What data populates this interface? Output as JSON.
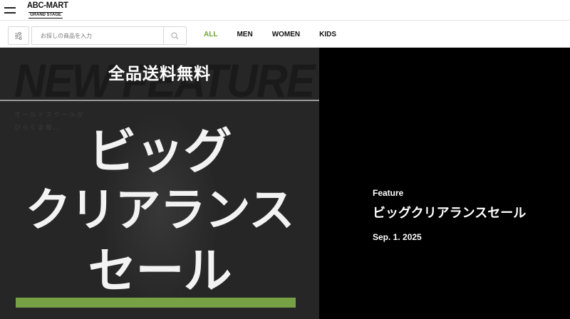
{
  "header": {
    "menu_icon": "hamburger-icon",
    "logo_main": "ABC-MART",
    "logo_sub": "GRAND STAGE"
  },
  "search": {
    "filter_icon": "sliders-icon",
    "placeholder": "お探しの商品を入力",
    "value": "",
    "search_icon": "search-icon"
  },
  "nav": {
    "tabs": [
      {
        "label": "ALL",
        "active": true
      },
      {
        "label": "MEN",
        "active": false
      },
      {
        "label": "WOMEN",
        "active": false
      },
      {
        "label": "KIDS",
        "active": false
      }
    ],
    "active_color": "#6aa52a"
  },
  "banner": {
    "top_text": "全品送料無料",
    "lines": [
      "ビッグ",
      "クリアランス",
      "セール"
    ],
    "background_text": "NEW FEATURE",
    "background_sub": [
      "オールドスクールが",
      "ひらくま毎…"
    ],
    "bar_color": "#76a145"
  },
  "feature": {
    "label": "Feature",
    "title": "ビッグクリアランスセール",
    "date": "Sep. 1. 2025"
  }
}
